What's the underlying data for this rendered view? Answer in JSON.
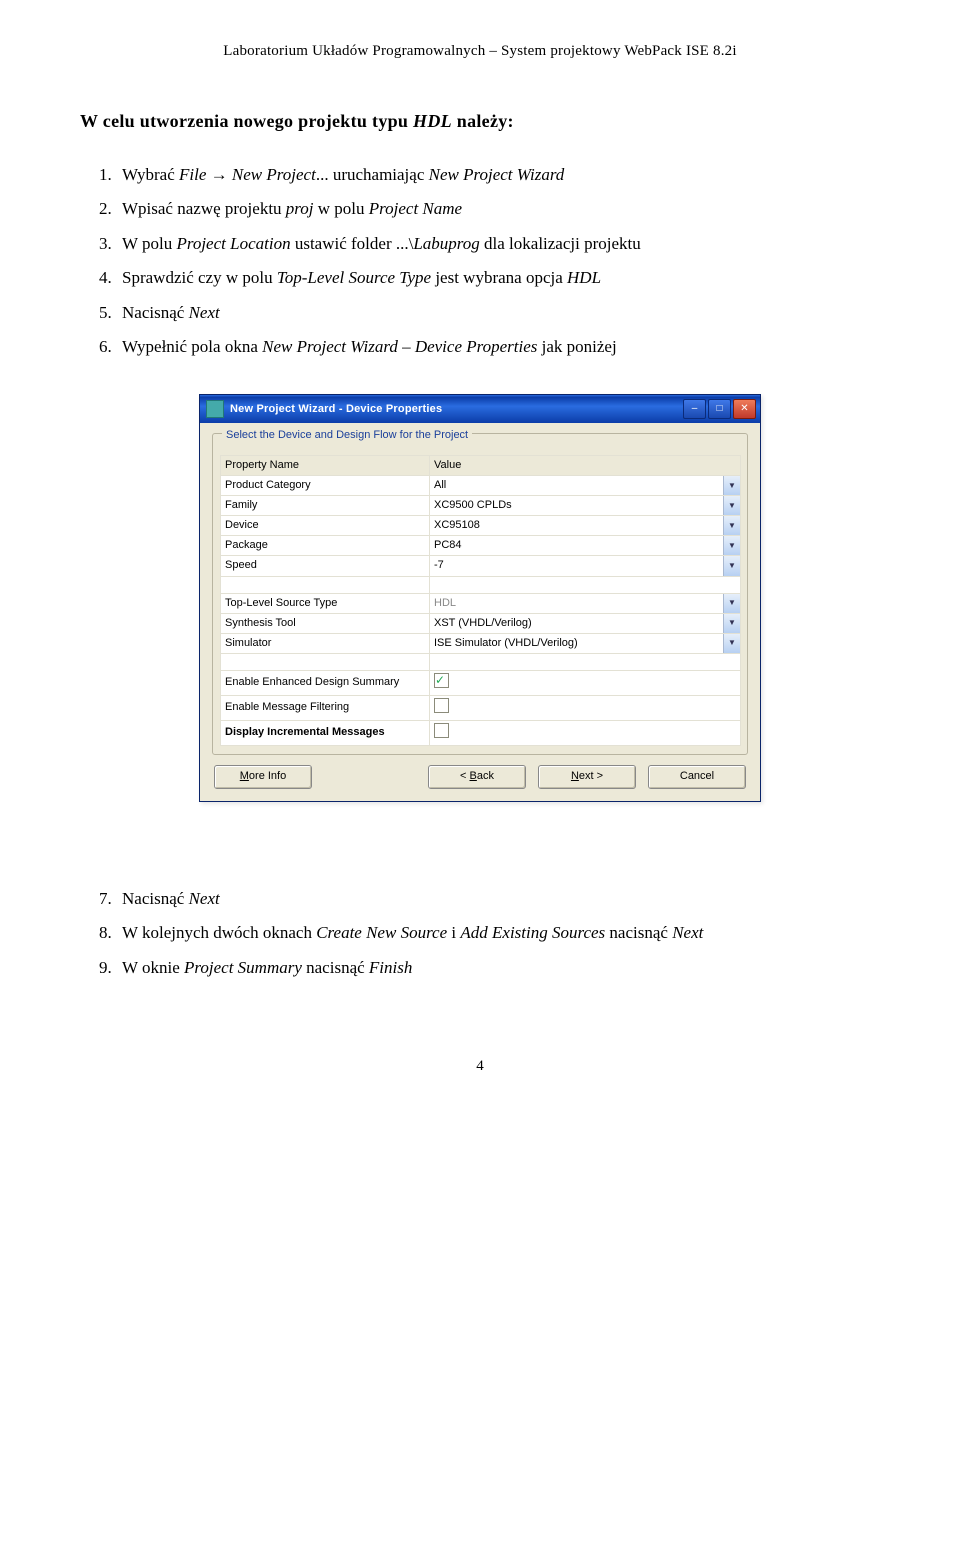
{
  "doc_header": "Laboratorium Układów Programowalnych – System projektowy WebPack ISE 8.2i",
  "section_title_prefix": "W celu utworzenia nowego projektu typu ",
  "section_title_em": "HDL",
  "section_title_suffix": " należy:",
  "steps1": [
    {
      "pre": "Wybrać ",
      "it1": "File",
      "mid": " → ",
      "it2": "New Project",
      "post": "... uruchamiając ",
      "it3": "New Project Wizard"
    },
    {
      "pre": "Wpisać nazwę projektu ",
      "it1": "proj",
      "mid": " w polu ",
      "it2": "Project Name"
    },
    {
      "pre": "W polu ",
      "it1": "Project Location",
      "mid": " ustawić folder ...\\",
      "it2": "Labuprog",
      "post": " dla lokalizacji projektu"
    },
    {
      "pre": "Sprawdzić czy w polu ",
      "it1": "Top-Level Source Type",
      "mid": " jest wybrana opcja ",
      "it2": "HDL"
    },
    {
      "pre": "Nacisnąć ",
      "it1": "Next"
    },
    {
      "pre": "Wypełnić pola okna ",
      "it1": "New Project Wizard – Device Properties",
      "mid": " jak poniżej"
    }
  ],
  "dialog": {
    "title": "New Project Wizard - Device Properties",
    "legend": "Select the Device and Design Flow for the Project",
    "header_left": "Property Name",
    "header_right": "Value",
    "rows_top": [
      {
        "name": "Product Category",
        "value": "All",
        "drop": true
      },
      {
        "name": "Family",
        "value": "XC9500 CPLDs",
        "drop": true
      },
      {
        "name": "Device",
        "value": "XC95108",
        "drop": true
      },
      {
        "name": "Package",
        "value": "PC84",
        "drop": true
      },
      {
        "name": "Speed",
        "value": "-7",
        "drop": true
      }
    ],
    "rows_mid": [
      {
        "name": "Top-Level Source Type",
        "value": "HDL",
        "drop": true,
        "disabled": true
      },
      {
        "name": "Synthesis Tool",
        "value": "XST (VHDL/Verilog)",
        "drop": true
      },
      {
        "name": "Simulator",
        "value": "ISE Simulator (VHDL/Verilog)",
        "drop": true
      }
    ],
    "rows_chk": [
      {
        "name": "Enable Enhanced Design Summary",
        "checked": true
      },
      {
        "name": "Enable Message Filtering",
        "checked": false
      },
      {
        "name": "Display Incremental Messages",
        "checked": false,
        "bold": true
      }
    ],
    "buttons": {
      "more": "More Info",
      "back": "< Back",
      "next": "Next >",
      "cancel": "Cancel"
    }
  },
  "steps2": [
    {
      "pre": "Nacisnąć ",
      "it1": "Next"
    },
    {
      "pre": "W kolejnych dwóch oknach ",
      "it1": "Create New Source",
      "mid": " i ",
      "it2": "Add Existing Sources",
      "post": " nacisnąć ",
      "it3": "Next"
    },
    {
      "pre": "W oknie ",
      "it1": "Project Summary",
      "mid": " nacisnąć ",
      "it2": "Finish"
    }
  ],
  "page_number": "4"
}
